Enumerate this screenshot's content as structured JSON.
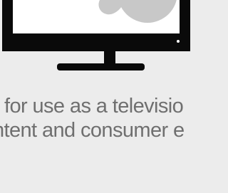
{
  "illustration": {
    "icon": "television-icon",
    "frame_color": "#0a0a0a",
    "screen_color": "#ffffff",
    "shape_color": "#c8c8c8",
    "background_color": "#ececec"
  },
  "caption": {
    "line1": "for use as a televisio",
    "line2": "ntent and consumer e",
    "text_color": "#6f6f6f"
  }
}
